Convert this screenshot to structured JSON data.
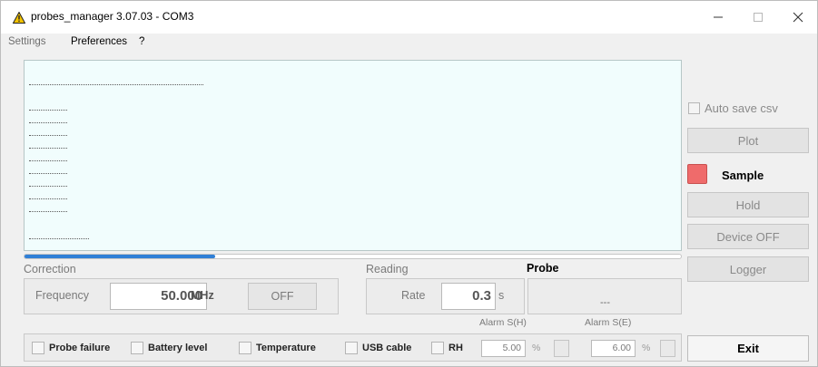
{
  "window": {
    "title": "probes_manager 3.07.03 - COM3",
    "controls": {
      "minimize": "—",
      "maximize": "☐",
      "close": "✕"
    },
    "icon": "warning-triangle-icon"
  },
  "menu": {
    "settings": "Settings",
    "preferences": "Preferences",
    "help": "?"
  },
  "console": {
    "line_count": 10,
    "progress_fraction": 0.29
  },
  "correction": {
    "section_label": "Correction",
    "frequency_label": "Frequency",
    "frequency_value": "50.000",
    "frequency_unit": "MHz",
    "off_button": "OFF"
  },
  "reading": {
    "section_label": "Reading",
    "rate_label": "Rate",
    "rate_value": "0.3",
    "rate_unit": "s"
  },
  "probe": {
    "section_label": "Probe",
    "value": "---"
  },
  "side_panel": {
    "auto_save_label": "Auto save csv",
    "plot_button": "Plot",
    "sample_label": "Sample",
    "sample_led_color": "#ef6b6b",
    "hold_button": "Hold",
    "device_off_button": "Device OFF",
    "logger_button": "Logger",
    "exit_button": "Exit"
  },
  "status": {
    "items": [
      {
        "label": "Probe failure"
      },
      {
        "label": "Battery level"
      },
      {
        "label": "Temperature"
      },
      {
        "label": "USB cable"
      },
      {
        "label": "RH"
      }
    ]
  },
  "alarms": {
    "h": {
      "label": "Alarm S(H)",
      "value": "5.00",
      "unit": "%"
    },
    "e": {
      "label": "Alarm S(E)",
      "value": "6.00",
      "unit": "%"
    }
  },
  "colors": {
    "console_bg": "#f1fdfd",
    "progress": "#2f7fd6"
  }
}
